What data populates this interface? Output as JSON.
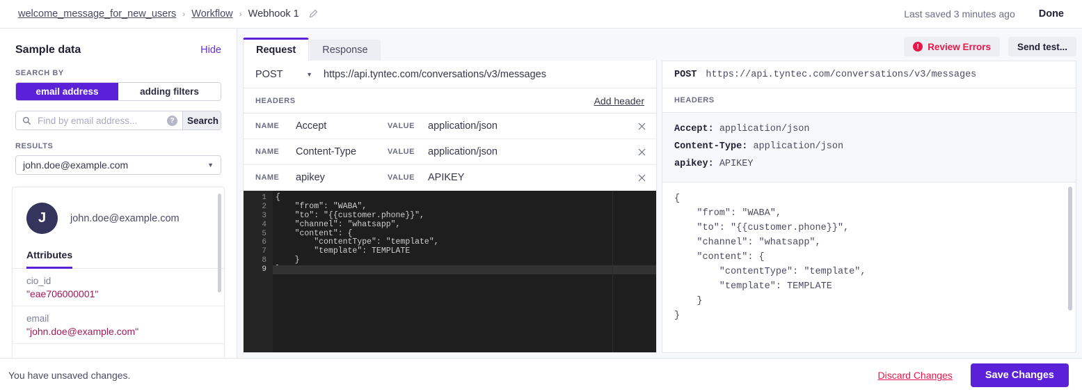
{
  "topbar": {
    "breadcrumb": [
      {
        "label": "welcome_message_for_new_users",
        "type": "link"
      },
      {
        "label": "Workflow",
        "type": "link"
      },
      {
        "label": "Webhook 1",
        "type": "current"
      }
    ],
    "separator": "›",
    "last_saved": "Last saved 3 minutes ago",
    "done_label": "Done",
    "edit_icon": "pencil-icon"
  },
  "sidebar": {
    "title": "Sample data",
    "hide_label": "Hide",
    "search_by_label": "SEARCH BY",
    "toggles": [
      {
        "label": "email address",
        "active": true
      },
      {
        "label": "adding filters",
        "active": false
      }
    ],
    "search": {
      "placeholder": "Find by email address...",
      "value": "",
      "icon": "search-icon",
      "help_icon": "question-mark-icon",
      "button_label": "Search"
    },
    "results_label": "RESULTS",
    "results_selected": "john.doe@example.com",
    "profile": {
      "avatar_initial": "J",
      "email": "john.doe@example.com",
      "tab_label": "Attributes",
      "attributes": [
        {
          "key": "cio_id",
          "value": "\"eae706000001\""
        },
        {
          "key": "email",
          "value": "\"john.doe@example.com\""
        }
      ]
    }
  },
  "main": {
    "tabs": [
      {
        "label": "Request",
        "active": true
      },
      {
        "label": "Response",
        "active": false
      }
    ],
    "actions": {
      "review_errors_label": "Review Errors",
      "review_errors_icon": "error-exclamation-icon",
      "send_test_label": "Send test..."
    },
    "request": {
      "method": "POST",
      "url": "https://api.tyntec.com/conversations/v3/messages",
      "headers_label": "HEADERS",
      "add_header_label": "Add header",
      "name_tag": "NAME",
      "value_tag": "VALUE",
      "remove_icon": "close-x-icon",
      "headers": [
        {
          "name": "Accept",
          "value": "application/json"
        },
        {
          "name": "Content-Type",
          "value": "application/json"
        },
        {
          "name": "apikey",
          "value": "APIKEY"
        }
      ],
      "body_lines": [
        "{",
        "    \"from\": \"WABA\",",
        "    \"to\": \"{{customer.phone}}\",",
        "    \"channel\": \"whatsapp\",",
        "    \"content\": {",
        "        \"contentType\": \"template\",",
        "        \"template\": TEMPLATE",
        "    }",
        "}"
      ],
      "active_line": 9
    },
    "preview": {
      "method": "POST",
      "url": "https://api.tyntec.com/conversations/v3/messages",
      "headers_label": "HEADERS",
      "headers": [
        {
          "name": "Accept",
          "value": "application/json"
        },
        {
          "name": "Content-Type",
          "value": "application/json"
        },
        {
          "name": "apikey",
          "value": "APIKEY"
        }
      ],
      "body": "{\n    \"from\": \"WABA\",\n    \"to\": \"{{customer.phone}}\",\n    \"channel\": \"whatsapp\",\n    \"content\": {\n        \"contentType\": \"template\",\n        \"template\": TEMPLATE\n    }\n}"
    }
  },
  "bottombar": {
    "message": "You have unsaved changes.",
    "discard_label": "Discard Changes",
    "save_label": "Save Changes"
  },
  "colors": {
    "accent_purple": "#5b21d8",
    "danger_red": "#e8174a",
    "attr_value": "#a2195b",
    "editor_bg": "#1e1e1e",
    "panel_bg": "#f7f8fb"
  }
}
